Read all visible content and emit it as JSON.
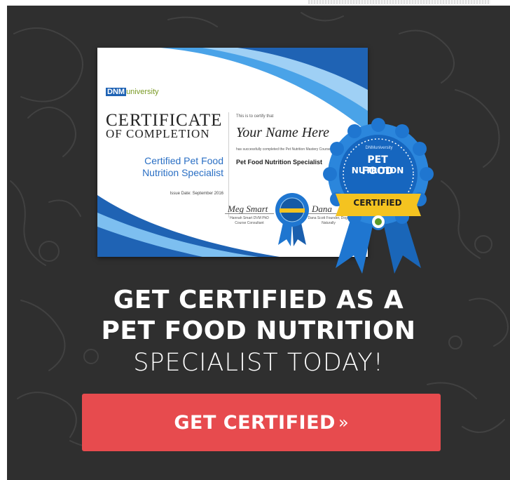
{
  "certificate": {
    "logo_prefix": "DNM",
    "logo_suffix": "university",
    "title_line1": "CERTIFICATE",
    "title_line2": "OF COMPLETION",
    "program_line1": "Certified Pet Food",
    "program_line2": "Nutrition Specialist",
    "issue_date": "Issue Date: September 2016",
    "presented_to": "This is to certify that",
    "recipient_name": "Your Name Here",
    "completed_text": "has successfully completed the Pet Nutrition Mastery Course with Dogs Naturally and",
    "course_name": "Pet Food Nutrition Specialist",
    "signature1": "Meg Smart",
    "signature1_title": "Hannah Smart DVM PhD Course Consultant",
    "signature2": "Dana",
    "signature2_title": "Dana Scott Founder, Dogs Naturally"
  },
  "badge": {
    "brand": "DNMuniversity",
    "line1": "PET FOOD",
    "line2": "NUTRITION",
    "ribbon_text": "CERTIFIED"
  },
  "headline": {
    "line1": "GET CERTIFIED AS A",
    "line2": "PET FOOD NUTRITION",
    "line3": "SPECIALIST TODAY!"
  },
  "cta": {
    "label": "GET CERTIFIED",
    "icon": "»"
  },
  "colors": {
    "banner_bg": "#2f2f2f",
    "cta_bg": "#e74b4e",
    "badge_blue": "#1f76d0",
    "ribbon_gold": "#f4c320",
    "text_white": "#ffffff"
  }
}
